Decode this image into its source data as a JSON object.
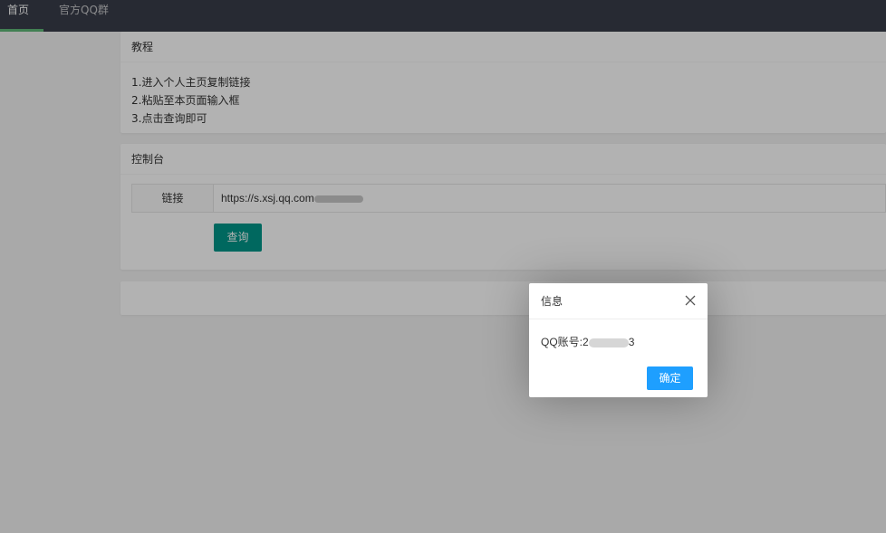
{
  "nav": {
    "home": "首页",
    "qq_group": "官方QQ群"
  },
  "tutorial": {
    "title": "教程",
    "steps": [
      "1.进入个人主页复制链接",
      "2.粘贴至本页面输入框",
      "3.点击查询即可"
    ]
  },
  "console": {
    "title": "控制台",
    "link_label": "链接",
    "link_value": "https://s.xsj.qq.com",
    "query_button": "查询"
  },
  "dialog": {
    "title": "信息",
    "content_prefix": "QQ账号:2",
    "content_suffix": "3",
    "ok_button": "确定"
  },
  "colors": {
    "nav_bg": "#393d49",
    "nav_active_underline": "#5fb878",
    "query_button": "#009688",
    "ok_button": "#1e9fff"
  }
}
